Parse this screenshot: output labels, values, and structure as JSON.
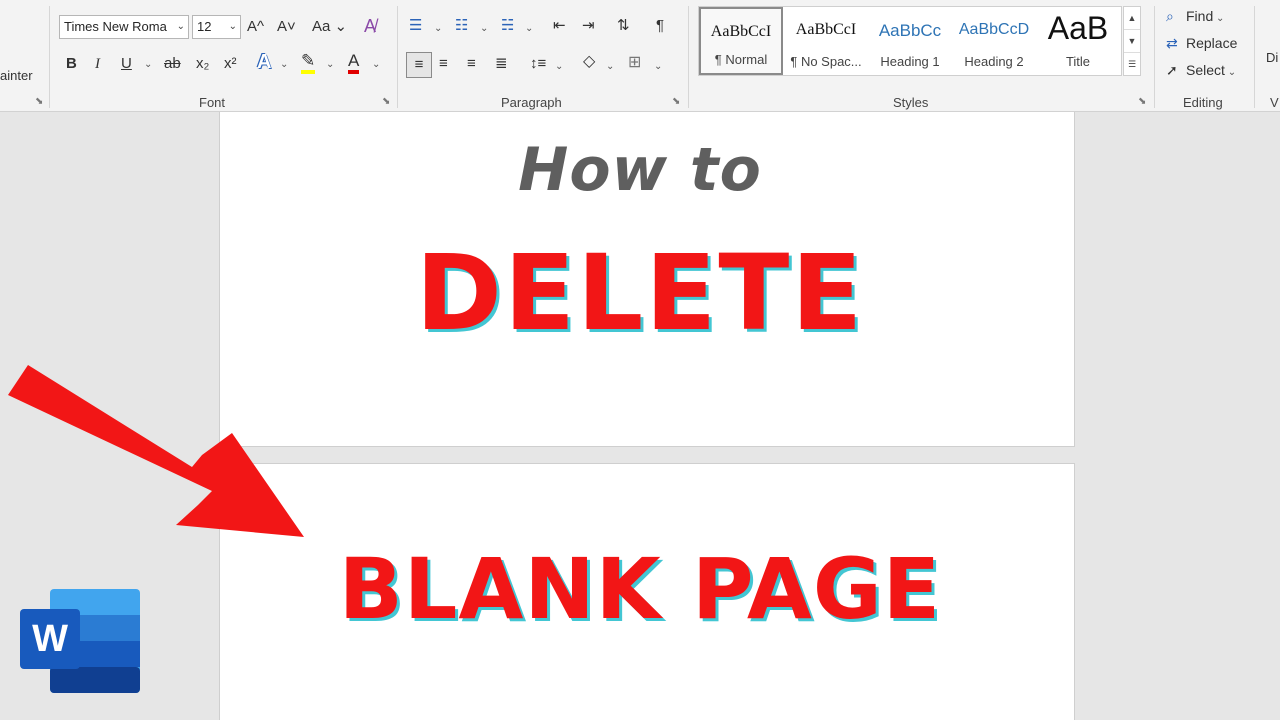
{
  "ribbon": {
    "clipboard": {
      "painter_label": "ainter"
    },
    "font": {
      "group_label": "Font",
      "font_name": "Times New Roma",
      "font_size": "12",
      "grow_label": "A^",
      "shrink_label": "A˅",
      "case_label": "Aa",
      "bold": "B",
      "italic": "I",
      "underline": "U",
      "strike": "ab",
      "subscript_label": "x₂",
      "superscript_label": "x²",
      "effects_label": "A",
      "font_color_label": "A",
      "font_color": "#e00000",
      "highlight_color": "#ffff00"
    },
    "paragraph": {
      "group_label": "Paragraph",
      "pilcrow": "¶"
    },
    "styles": {
      "group_label": "Styles",
      "items": [
        {
          "preview": "AaBbCcI",
          "name": "¶ Normal"
        },
        {
          "preview": "AaBbCcI",
          "name": "¶ No Spac..."
        },
        {
          "preview": "AaBbCc",
          "name": "Heading 1"
        },
        {
          "preview": "AaBbCcD",
          "name": "Heading 2"
        },
        {
          "preview": "AaB",
          "name": "Title"
        }
      ]
    },
    "editing": {
      "group_label": "Editing",
      "find": "Find",
      "replace": "Replace",
      "select": "Select"
    },
    "voice": {
      "dictate_partial": "Di",
      "group_partial": "V"
    }
  },
  "document": {
    "line1": "How to",
    "line2": "DELETE",
    "line3": "BLANK PAGE"
  },
  "overlay": {
    "arrow_color": "#f21616",
    "app_icon_letter": "W",
    "accent": "#43c6d3"
  }
}
